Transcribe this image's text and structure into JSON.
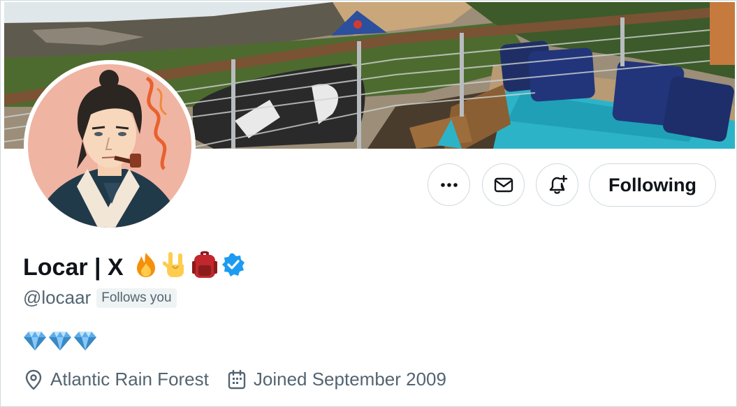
{
  "profile": {
    "display_name": "Locar | X",
    "name_emojis": [
      "fire-emoji",
      "rock-on-hand-emoji",
      "backpack-emoji"
    ],
    "verified": true,
    "handle": "@locaar",
    "follows_you_label": "Follows you",
    "bio_emojis": [
      "gem-emoji",
      "gem-emoji",
      "gem-emoji"
    ],
    "location": "Atlantic Rain Forest",
    "joined": "Joined September 2009"
  },
  "actions": {
    "more_icon": "more-dots-icon",
    "message_icon": "envelope-icon",
    "notify_icon": "bell-plus-icon",
    "following_label": "Following"
  },
  "colors": {
    "verified": "#1d9bf0",
    "text_primary": "#0f1419",
    "text_secondary": "#536471",
    "border": "#cfd9de"
  }
}
